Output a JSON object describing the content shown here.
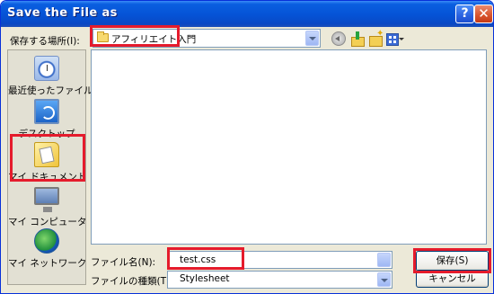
{
  "window": {
    "title": "Save the File as"
  },
  "titlebar_buttons": {
    "help": "?",
    "close": "✕"
  },
  "location": {
    "label": "保存する場所(I):",
    "value": "アフィリエイト入門"
  },
  "places": [
    {
      "label": "最近使ったファイル",
      "icon": "recent-icon"
    },
    {
      "label": "デスクトップ",
      "icon": "desktop-icon"
    },
    {
      "label": "マイ ドキュメント",
      "icon": "my-documents-icon"
    },
    {
      "label": "マイ コンピュータ",
      "icon": "my-computer-icon"
    },
    {
      "label": "マイ ネットワーク",
      "icon": "my-network-icon"
    }
  ],
  "filename": {
    "label": "ファイル名(N):",
    "value": "test.css"
  },
  "filetype": {
    "label": "ファイルの種類(T):",
    "value": "Stylesheet"
  },
  "buttons": {
    "save": "保存(S)",
    "cancel": "キャンセル"
  },
  "colors": {
    "titlebar": "#0553d6",
    "highlight": "#e51b2c",
    "dialog_bg": "#ece9d8"
  }
}
